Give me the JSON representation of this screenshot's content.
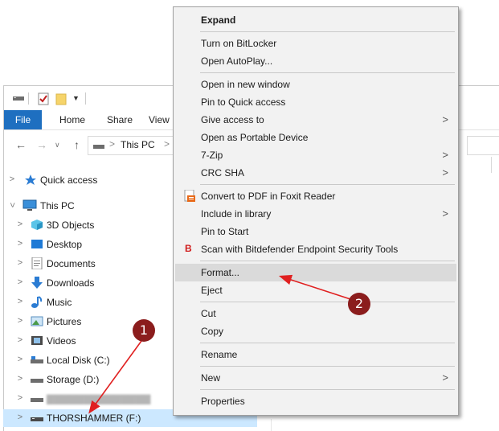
{
  "explorer": {
    "ribbon_tabs": [
      "File",
      "Home",
      "Share",
      "View"
    ],
    "address": {
      "segment": "This PC",
      "separator": ">"
    },
    "nav": {
      "back": "←",
      "forward": "→",
      "dropdown": "∨",
      "up": "↑"
    },
    "tree": [
      {
        "label": "Quick access",
        "icon": "star-icon",
        "level": 0
      },
      {
        "label": "This PC",
        "icon": "monitor-icon",
        "level": 0,
        "expanded": true
      },
      {
        "label": "3D Objects",
        "icon": "cube-icon",
        "level": 1
      },
      {
        "label": "Desktop",
        "icon": "desktop-icon",
        "level": 1
      },
      {
        "label": "Documents",
        "icon": "document-icon",
        "level": 1
      },
      {
        "label": "Downloads",
        "icon": "download-icon",
        "level": 1
      },
      {
        "label": "Music",
        "icon": "music-icon",
        "level": 1
      },
      {
        "label": "Pictures",
        "icon": "pictures-icon",
        "level": 1
      },
      {
        "label": "Videos",
        "icon": "video-icon",
        "level": 1
      },
      {
        "label": "Local Disk (C:)",
        "icon": "drive-icon",
        "level": 1
      },
      {
        "label": "Storage (D:)",
        "icon": "drive-icon",
        "level": 1
      },
      {
        "label": "",
        "icon": "drive-icon",
        "level": 1,
        "redacted": true
      },
      {
        "label": "THORSHAMMER (F:)",
        "icon": "usb-drive-icon",
        "level": 1,
        "selected": true
      }
    ]
  },
  "context_menu": {
    "items": [
      {
        "label": "Expand",
        "bold": true
      },
      {
        "separator": true
      },
      {
        "label": "Turn on BitLocker"
      },
      {
        "label": "Open AutoPlay..."
      },
      {
        "separator": true
      },
      {
        "label": "Open in new window"
      },
      {
        "label": "Pin to Quick access"
      },
      {
        "label": "Give access to",
        "submenu": true
      },
      {
        "label": "Open as Portable Device"
      },
      {
        "label": "7-Zip",
        "submenu": true
      },
      {
        "label": "CRC SHA",
        "submenu": true
      },
      {
        "separator": true
      },
      {
        "label": "Convert to PDF in Foxit Reader",
        "icon": "foxit-pdf-icon"
      },
      {
        "label": "Include in library",
        "submenu": true
      },
      {
        "label": "Pin to Start"
      },
      {
        "label": "Scan with Bitdefender Endpoint Security Tools",
        "icon": "bitdefender-icon"
      },
      {
        "separator": true
      },
      {
        "label": "Format...",
        "highlighted": true
      },
      {
        "label": "Eject"
      },
      {
        "separator": true
      },
      {
        "label": "Cut"
      },
      {
        "label": "Copy"
      },
      {
        "separator": true
      },
      {
        "label": "Rename"
      },
      {
        "separator": true
      },
      {
        "label": "New",
        "submenu": true
      },
      {
        "separator": true
      },
      {
        "label": "Properties"
      }
    ]
  },
  "annotations": [
    {
      "number": "1",
      "color": "#8b1d1d"
    },
    {
      "number": "2",
      "color": "#8b1d1d"
    }
  ],
  "colors": {
    "accent": "#1e6fc0",
    "selection": "#cce8ff",
    "menu_bg": "#f2f2f2",
    "menu_highlight": "#dadada",
    "arrow": "#e02020"
  }
}
